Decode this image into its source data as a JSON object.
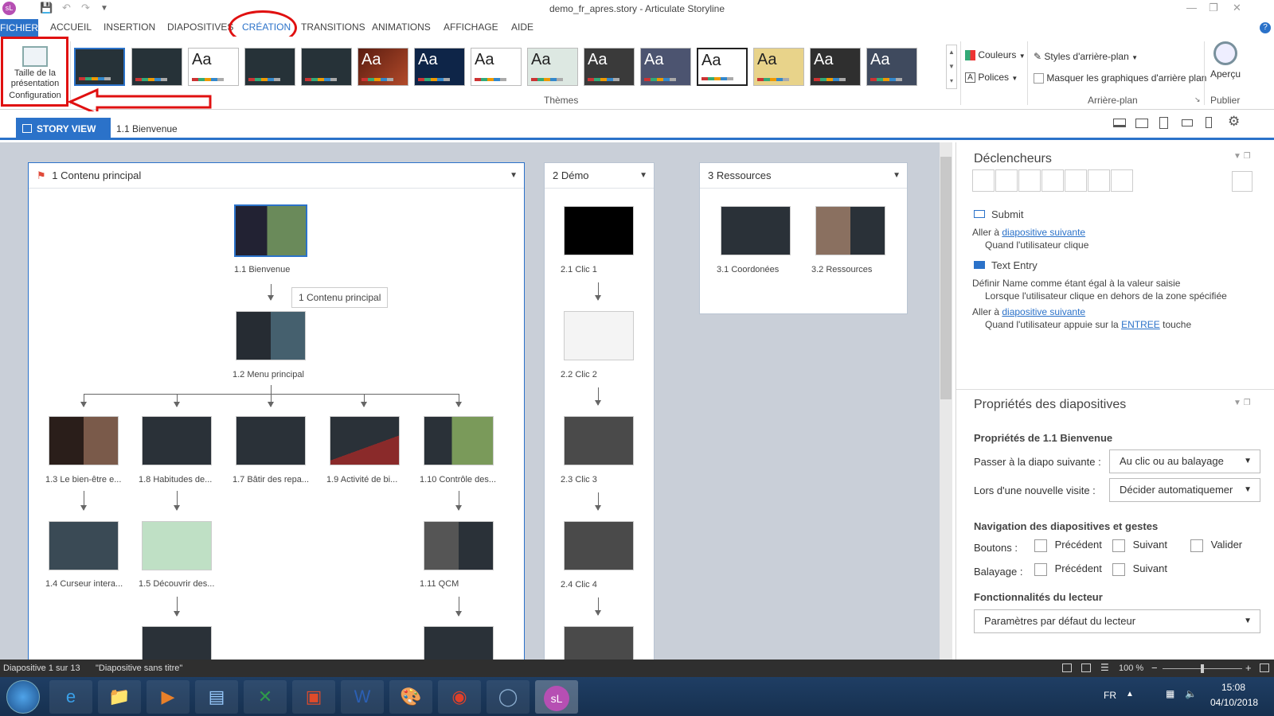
{
  "window": {
    "title": "demo_fr_apres.story -  Articulate Storyline",
    "app_icon": "sL"
  },
  "tabs": [
    "FICHIER",
    "ACCUEIL",
    "INSERTION",
    "DIAPOSITIVES",
    "CRÉATION",
    "TRANSITIONS",
    "ANIMATIONS",
    "AFFICHAGE",
    "AIDE"
  ],
  "ribbon": {
    "size_button": "Taille de la présentation",
    "config_label": "Configuration",
    "themes_label": "Thèmes",
    "theme_sample": "Aa",
    "couleurs": "Couleurs",
    "polices": "Polices",
    "styles_bg": "Styles d'arrière-plan",
    "hide_bg": "Masquer les graphiques d'arrière plan",
    "bg_label": "Arrière-plan",
    "apercu": "Aperçu",
    "publier": "Publier"
  },
  "storybar": {
    "tab": "STORY VIEW",
    "current": "1.1 Bienvenue"
  },
  "scenes": {
    "s1": {
      "title": "1 Contenu principal",
      "tooltip": "1 Contenu principal",
      "slides": [
        "1.1 Bienvenue",
        "1.2 Menu principal",
        "1.3 Le bien-être e...",
        "1.8 Habitudes de...",
        "1.7 Bâtir des repa...",
        "1.9 Activité de bi...",
        "1.10 Contrôle des...",
        "1.4 Curseur intera...",
        "1.5 Découvrir des...",
        "1.11 QCM"
      ]
    },
    "s2": {
      "title": "2 Démo",
      "slides": [
        "2.1 Clic 1",
        "2.2 Clic 2",
        "2.3 Clic 3",
        "2.4 Clic 4"
      ]
    },
    "s3": {
      "title": "3 Ressources",
      "slides": [
        "3.1 Coordonées",
        "3.2 Ressources"
      ]
    }
  },
  "triggers": {
    "title": "Déclencheurs",
    "submit": "Submit",
    "goto1": "Aller à",
    "goto1_link": "diapositive suivante",
    "cond1": "Quand l'utilisateur clique",
    "text_entry": "Text Entry",
    "set_name": "Définir Name comme étant égal à la valeur saisie",
    "cond2": "Lorsque l'utilisateur clique en dehors de la zone spécifiée",
    "goto2": "Aller à",
    "goto2_link": "diapositive suivante",
    "cond3_pre": "Quand l'utilisateur appuie sur la",
    "cond3_key": "ENTREE",
    "cond3_post": "touche"
  },
  "props": {
    "title": "Propriétés des diapositives",
    "subtitle": "Propriétés de 1.1 Bienvenue",
    "next_label": "Passer à la diapo suivante :",
    "next_value": "Au clic ou au balayage",
    "revisit_label": "Lors d'une nouvelle visite :",
    "revisit_value": "Décider automatiquemer",
    "nav_title": "Navigation des diapositives et gestes",
    "buttons_label": "Boutons :",
    "swipe_label": "Balayage :",
    "prev": "Précédent",
    "next": "Suivant",
    "submit": "Valider",
    "player_title": "Fonctionnalités du lecteur",
    "player_value": "Paramètres par défaut du lecteur"
  },
  "status": {
    "slide": "Diapositive 1 sur 13",
    "name": "\"Diapositive sans titre\"",
    "zoom": "100 %",
    "zoom_level": 0.5
  },
  "taskbar": {
    "lang": "FR",
    "time": "15:08",
    "date": "04/10/2018"
  },
  "colors": {
    "accent": "#2b72c9",
    "annotation": "#e01010"
  }
}
